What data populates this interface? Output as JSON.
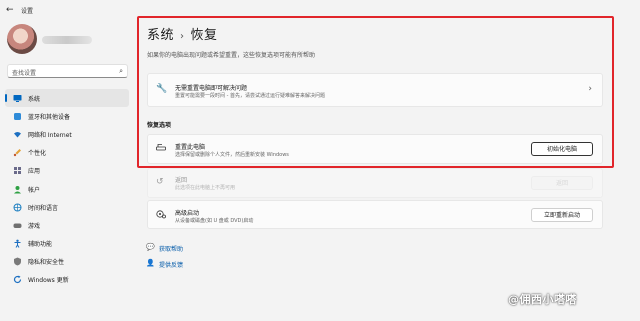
{
  "window": {
    "title": "设置",
    "back_icon": "back-arrow-icon"
  },
  "search": {
    "placeholder": "查找设置"
  },
  "sidebar": {
    "items": [
      {
        "label": "系统",
        "icon": "monitor-icon",
        "active": true
      },
      {
        "label": "蓝牙和其他设备",
        "icon": "bluetooth-icon"
      },
      {
        "label": "网络和 Internet",
        "icon": "wifi-icon"
      },
      {
        "label": "个性化",
        "icon": "brush-icon"
      },
      {
        "label": "应用",
        "icon": "apps-icon"
      },
      {
        "label": "帐户",
        "icon": "person-icon"
      },
      {
        "label": "时间和语言",
        "icon": "globe-icon"
      },
      {
        "label": "游戏",
        "icon": "gamepad-icon"
      },
      {
        "label": "辅助功能",
        "icon": "accessibility-icon"
      },
      {
        "label": "隐私和安全性",
        "icon": "shield-icon"
      },
      {
        "label": "Windows 更新",
        "icon": "update-icon"
      }
    ]
  },
  "main": {
    "breadcrumb": {
      "parent": "系统",
      "separator": "›",
      "current": "恢复"
    },
    "subtitle": "如果你的电脑出现问题或希望重置，这些恢复选项可能有所帮助",
    "troubleshoot": {
      "title": "无需重置电脑即可解决问题",
      "subtitle": "重置可能需要一段时间 - 首先，请尝试通过运行疑难解答来解决问题"
    },
    "section_header": "恢复选项",
    "reset": {
      "title": "重置此电脑",
      "subtitle": "选择保留或删除个人文件，然后重新安装 Windows",
      "button": "初始化电脑"
    },
    "goback": {
      "title": "返回",
      "subtitle": "此选项在此电脑上不再可用",
      "button": "返回"
    },
    "advanced": {
      "title": "高级启动",
      "subtitle": "从设备或磁盘(如 U 盘或 DVD)启动",
      "button": "立即重新启动"
    }
  },
  "help_links": [
    {
      "label": "获取帮助",
      "icon": "help-chat-icon"
    },
    {
      "label": "提供反馈",
      "icon": "feedback-icon"
    }
  ],
  "watermark": "@佣西小嗒嗒",
  "colors": {
    "accent": "#0067c0",
    "highlight_border": "#e1252a"
  }
}
